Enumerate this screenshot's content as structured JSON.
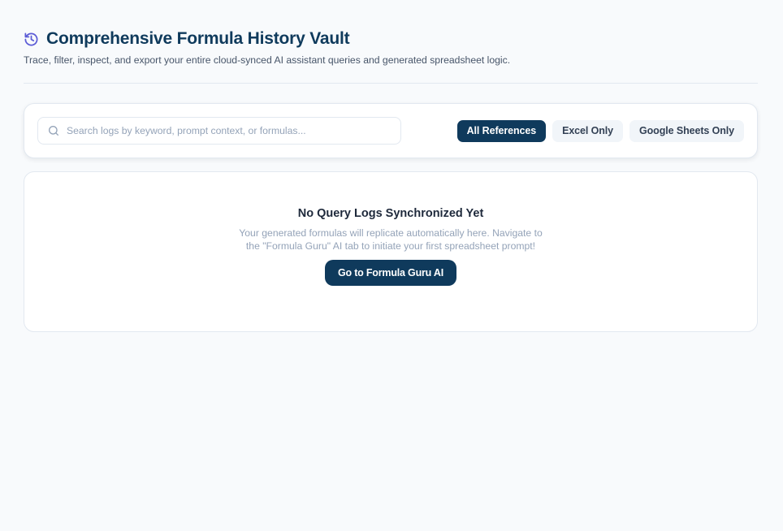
{
  "header": {
    "icon": "history-icon",
    "title": "Comprehensive Formula History Vault",
    "subtitle": "Trace, filter, inspect, and export your entire cloud-synced AI assistant queries and generated spreadsheet logic."
  },
  "filters": {
    "search": {
      "icon": "search-icon",
      "value": "",
      "placeholder": "Search logs by keyword, prompt context, or formulas..."
    },
    "buttons": [
      {
        "label": "All References",
        "active": true
      },
      {
        "label": "Excel Only",
        "active": false
      },
      {
        "label": "Google Sheets Only",
        "active": false
      }
    ]
  },
  "empty_state": {
    "title": "No Query Logs Synchronized Yet",
    "message": "Your generated formulas will replicate automatically here. Navigate to the \"Formula Guru\" AI tab to initiate your first spreadsheet prompt!",
    "cta_label": "Go to Formula Guru AI"
  },
  "colors": {
    "accent": "#0f3a5c",
    "icon_accent": "#5b5bd6",
    "background": "#f8fafc"
  }
}
